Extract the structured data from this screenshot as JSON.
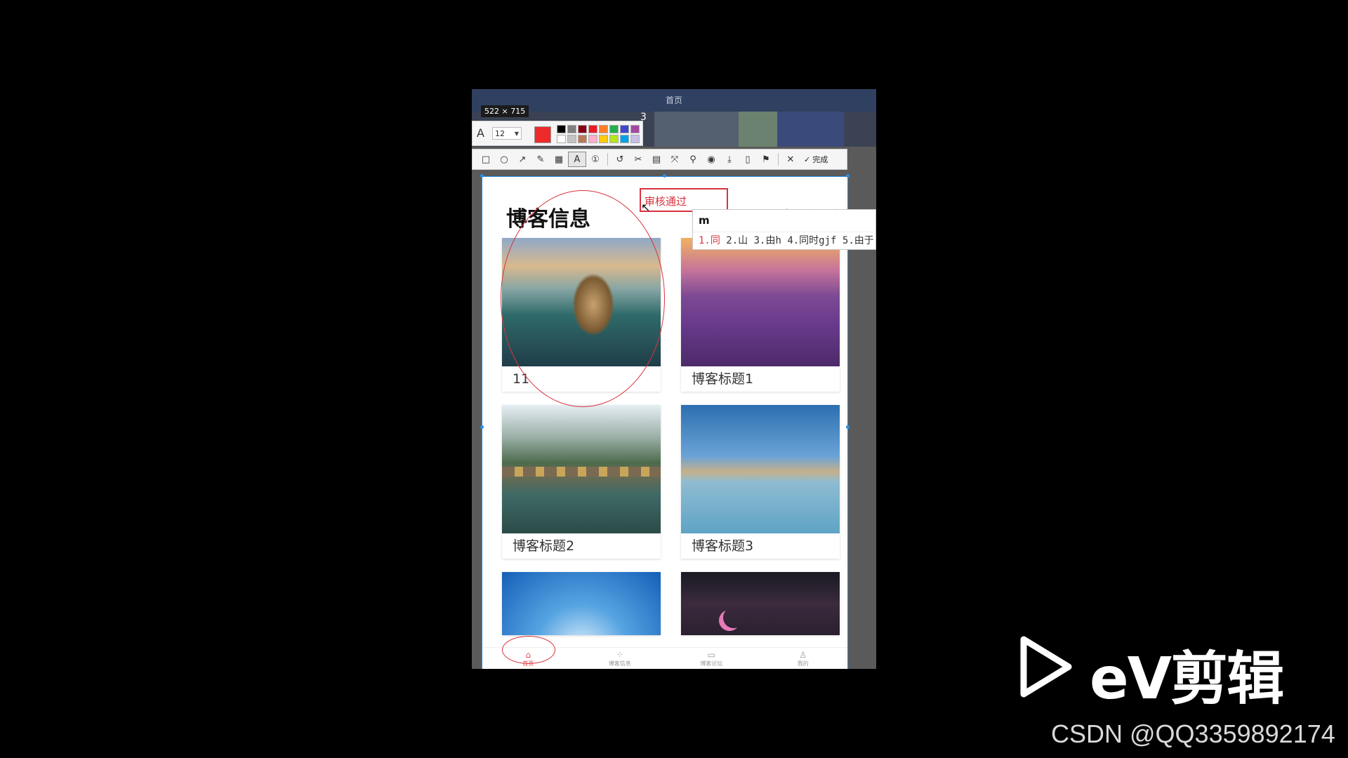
{
  "window": {
    "title": "首页"
  },
  "background_number": "3",
  "capture_tool": {
    "size_label": "522 × 715",
    "font_size": "12",
    "current_color": "#ee2a2a",
    "palette": [
      "#000000",
      "#7f7f7f",
      "#880015",
      "#ed1c24",
      "#ff7f27",
      "#22b14c",
      "#3f48cc",
      "#a349a4",
      "#ffffff",
      "#c3c3c3",
      "#b97a57",
      "#ffaec9",
      "#ffc90e",
      "#b5e61d",
      "#00a2e8",
      "#c8bfe7"
    ],
    "tools": [
      "rectangle-icon",
      "ellipse-icon",
      "arrow-icon",
      "pencil-icon",
      "mosaic-icon",
      "text-icon",
      "number-icon",
      "undo-icon",
      "clip-icon",
      "ocr-icon",
      "translate-icon",
      "pin-icon",
      "record-icon",
      "download-icon",
      "save-icon",
      "bookmark-icon"
    ],
    "cancel_label": "✕",
    "done_label": "完成"
  },
  "annotation": {
    "text": "审核通过"
  },
  "ime": {
    "composition": "m",
    "candidates": [
      "1.同",
      "2.山",
      "3.由h",
      "4.同时gjf",
      "5.由于"
    ]
  },
  "page": {
    "heading": "博客信息",
    "more_link": "查看更多",
    "cards": [
      {
        "title": "11",
        "image": "castle-lake"
      },
      {
        "title": "博客标题1",
        "image": "lavender-field"
      },
      {
        "title": "博客标题2",
        "image": "stone-bridge"
      },
      {
        "title": "博客标题3",
        "image": "mountain-lake"
      },
      {
        "title": "",
        "image": "blue-sky"
      },
      {
        "title": "",
        "image": "night-garden"
      }
    ]
  },
  "tabbar": [
    {
      "label": "首页",
      "icon": "home-icon",
      "active": true
    },
    {
      "label": "博客信息",
      "icon": "grid-icon",
      "active": false
    },
    {
      "label": "博客论坛",
      "icon": "chat-icon",
      "active": false
    },
    {
      "label": "我的",
      "icon": "user-icon",
      "active": false
    }
  ],
  "watermark": {
    "brand": "eV剪辑",
    "credit": "CSDN @QQ3359892174"
  }
}
